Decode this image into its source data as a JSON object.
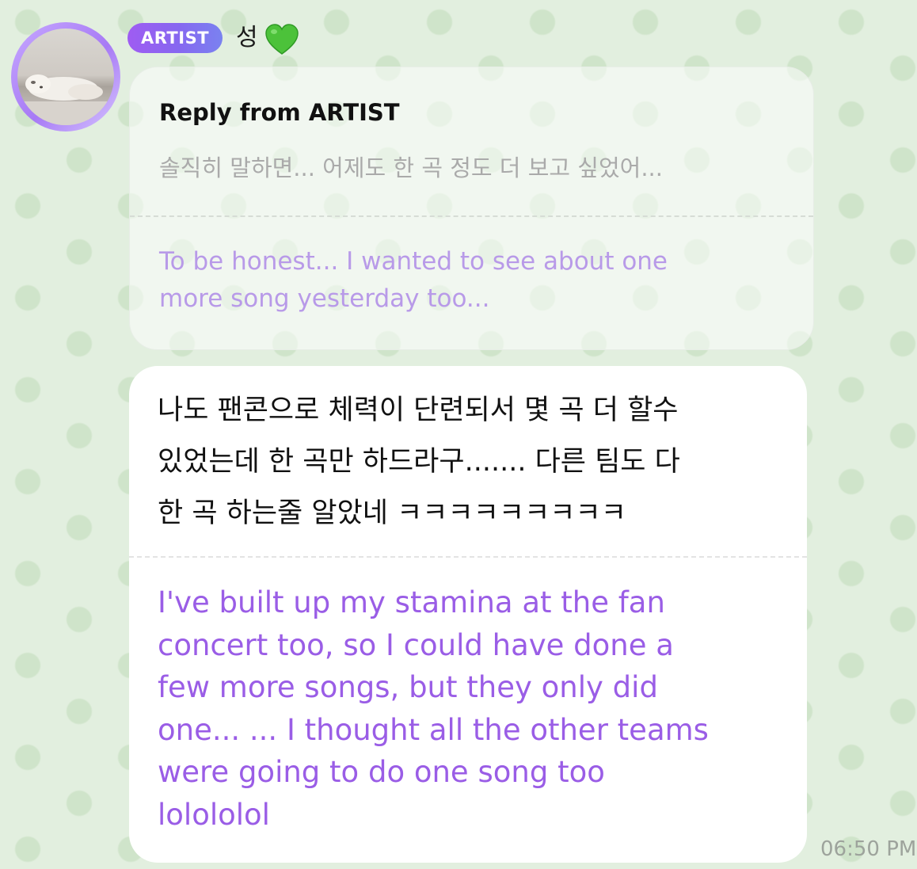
{
  "sender": {
    "badge": "ARTIST",
    "name": "성",
    "name_icon": "green-heart-icon",
    "avatar": "sleeping-white-dog-photo"
  },
  "reply": {
    "title": "Reply from ARTIST",
    "original_text": "솔직히 말하면... 어제도 한 곡 정도 더 보고 싶었어...",
    "translation": "To be honest... I wanted to see about one\nmore song yesterday too..."
  },
  "message": {
    "original_text": "나도 팬콘으로 체력이 단련되서 몇 곡 더 할수\n있었는데 한 곡만 하드라구....... 다른 팀도 다\n한 곡 하는줄 알았네 ㅋㅋㅋㅋㅋㅋㅋㅋㅋ",
    "translation": "I've built up my stamina at the fan\nconcert too, so I could have done a\nfew more songs, but they only did\none... ... I thought all the other teams\nwere going to do one song too\nlolololol",
    "timestamp": "06:50 PM"
  },
  "colors": {
    "background": "#e2efdf",
    "dots": "#cfe4ca",
    "badge_gradient_start": "#9f5cf2",
    "badge_gradient_end": "#7a82f0",
    "translation_text": "#9a5de6",
    "reply_translation_text": "#b89ae8",
    "heart": "#4cc23a"
  }
}
